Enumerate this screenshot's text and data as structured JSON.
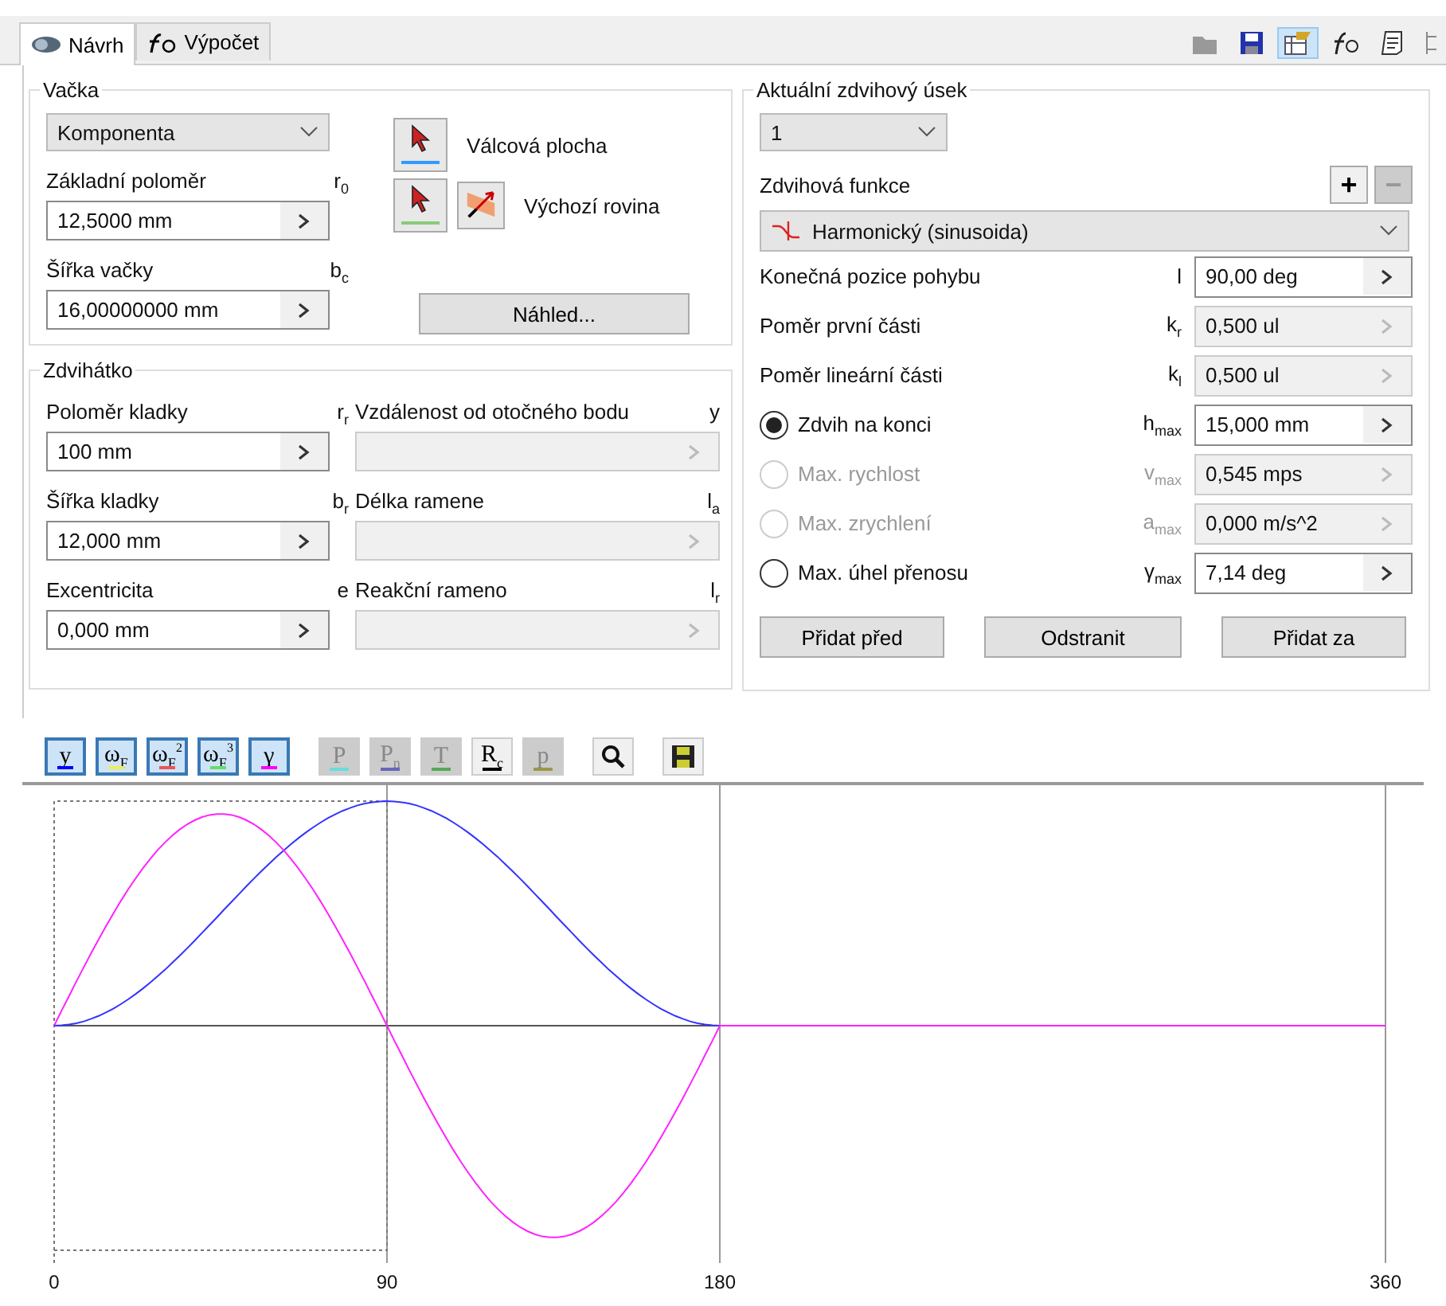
{
  "tabs": [
    {
      "label": "Návrh",
      "kind": "design",
      "selected": true
    },
    {
      "label": "Výpočet",
      "kind": "calc",
      "selected": false
    }
  ],
  "toolbar": [
    {
      "kind": "open",
      "selected": false
    },
    {
      "kind": "save",
      "selected": false
    },
    {
      "kind": "properties",
      "selected": true
    },
    {
      "kind": "function",
      "selected": false
    },
    {
      "kind": "notes",
      "selected": false
    },
    {
      "kind": "tree",
      "selected": false
    }
  ],
  "cam": {
    "title": "Vačka",
    "type_select": "Komponenta",
    "fields": [
      {
        "label": "Základní poloměr",
        "symbol": "r$_{0}$",
        "value": "12,5000 mm"
      },
      {
        "label": "Šířka vačky",
        "symbol": "b$_{c}$",
        "value": "16,00000000 mm"
      }
    ],
    "pickers": [
      {
        "label": "Válcová plocha",
        "color": "#3399ff"
      },
      {
        "label": "Výchozí rovina",
        "color": "#88cc77"
      }
    ],
    "preview_button": "Náhled..."
  },
  "follower": {
    "title": "Zdvihátko",
    "fields": [
      {
        "label": "Poloměr kladky",
        "symbol": "r$_{r}$",
        "value": "100 mm",
        "disabled": false
      },
      {
        "label": "Vzdálenost od otočného bodu",
        "symbol": "y",
        "disabled": true
      },
      {
        "label": "Šířka kladky",
        "symbol": "b$_{r}$",
        "value": "12,000 mm",
        "disabled": false
      },
      {
        "label": "Délka ramene",
        "symbol": "l$_{a}$",
        "disabled": true
      },
      {
        "label": "Excentricita",
        "symbol": "e",
        "value": "0,000 mm",
        "disabled": false
      },
      {
        "label": "Reakční rameno",
        "symbol": "l$_{r}$",
        "disabled": true
      }
    ]
  },
  "segment": {
    "title": "Aktuální zdvihový úsek",
    "select": "1",
    "function_label": "Zdvihová funkce",
    "add_button": {
      "label": "+",
      "disabled": false
    },
    "remove_button": {
      "label": "−",
      "disabled": true
    },
    "function_select": "Harmonický (sinusoida)",
    "params": [
      {
        "kind": "field",
        "label": "Konečná pozice pohybu",
        "symbol": "l",
        "value": "90,00 deg",
        "disabled": false
      },
      {
        "kind": "field",
        "label": "Poměr první části",
        "symbol": "k$_{r}$",
        "value": "0,500 ul",
        "disabled": true
      },
      {
        "kind": "field",
        "label": "Poměr lineární části",
        "symbol": "k$_{l}$",
        "value": "0,500 ul",
        "disabled": true
      },
      {
        "kind": "radio",
        "label": "Zdvih na konci",
        "symbol": "h$_{max}$",
        "value": "15,000 mm",
        "selected": true,
        "disabled": false
      },
      {
        "kind": "radio",
        "label": "Max. rychlost",
        "symbol": "v$_{max}$",
        "value": "0,545 mps",
        "selected": false,
        "disabled": true
      },
      {
        "kind": "radio",
        "label": "Max. zrychlení",
        "symbol": "a$_{max}$",
        "value": "0,000 m/s^2",
        "selected": false,
        "disabled": true
      },
      {
        "kind": "radio",
        "label": "Max. úhel přenosu",
        "symbol": "γ$_{max}$",
        "value": "7,14 deg",
        "selected": false,
        "disabled": false
      }
    ],
    "buttons": [
      "Přidat před",
      "Odstranit",
      "Přidat za"
    ]
  },
  "chart_toolbar": [
    {
      "kind": "toggle",
      "label": "y",
      "color": "#0000ff",
      "selected": true,
      "disabled": false
    },
    {
      "kind": "toggle",
      "label": "ω$_{F}$",
      "color": "#eeee55",
      "selected": true,
      "disabled": false
    },
    {
      "kind": "toggle",
      "label": "ω$_{F}$$^{2}$",
      "color": "#ee5555",
      "selected": true,
      "disabled": false
    },
    {
      "kind": "toggle",
      "label": "ω$_{F}$$^{3}$",
      "color": "#66dd66",
      "selected": true,
      "disabled": false
    },
    {
      "kind": "toggle",
      "label": "γ",
      "color": "#ff00ff",
      "selected": true,
      "disabled": false
    },
    {
      "kind": "toggle",
      "label": "P",
      "color": "#66dddd",
      "selected": false,
      "disabled": true
    },
    {
      "kind": "toggle",
      "label": "P$_{n}$",
      "color": "#6666bb",
      "selected": false,
      "disabled": true
    },
    {
      "kind": "toggle",
      "label": "T",
      "color": "#55aa55",
      "selected": false,
      "disabled": true
    },
    {
      "kind": "toggle",
      "label": "R$_{c}$",
      "color": "#000000",
      "selected": false,
      "disabled": false
    },
    {
      "kind": "toggle",
      "label": "p",
      "color": "#999944",
      "selected": false,
      "disabled": true
    },
    {
      "kind": "zoom",
      "selected": false,
      "disabled": false
    },
    {
      "kind": "save",
      "selected": false,
      "disabled": false
    }
  ],
  "plot": {
    "x_labels": [
      "0",
      "90",
      "180",
      "360"
    ]
  }
}
